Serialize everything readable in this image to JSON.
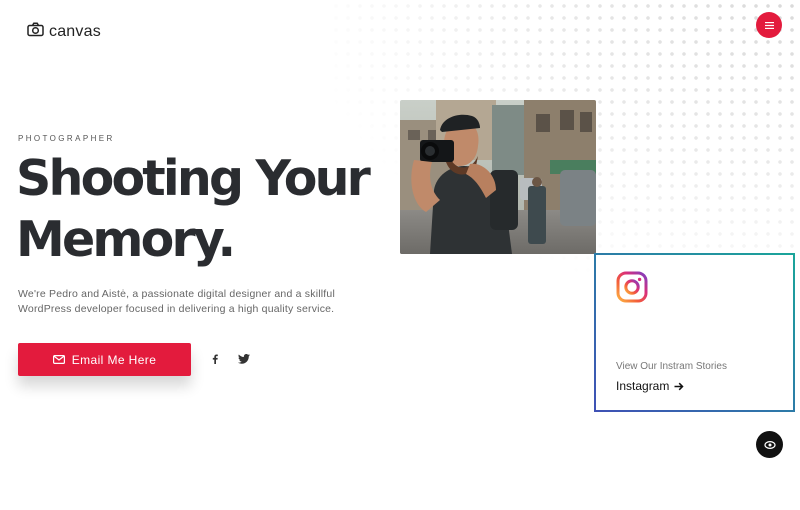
{
  "header": {
    "brand": "canvas",
    "menu_icon": "hamburger-icon"
  },
  "hero": {
    "eyebrow": "PHOTOGRAPHER",
    "headline_line1": "Shooting Your",
    "headline_line2": "Memory.",
    "description": "We're Pedro and Aistė, a passionate digital designer and a skillful WordPress developer focused in delivering a high quality service.",
    "cta_label": "Email Me Here"
  },
  "social": {
    "facebook_icon": "facebook-icon",
    "twitter_icon": "twitter-icon"
  },
  "instagram_card": {
    "caption": "View Our Instram Stories",
    "link_label": "Instagram"
  },
  "colors": {
    "accent": "#e31b3d",
    "heading": "#2a2c30",
    "text": "#666666",
    "fab": "#111111"
  }
}
